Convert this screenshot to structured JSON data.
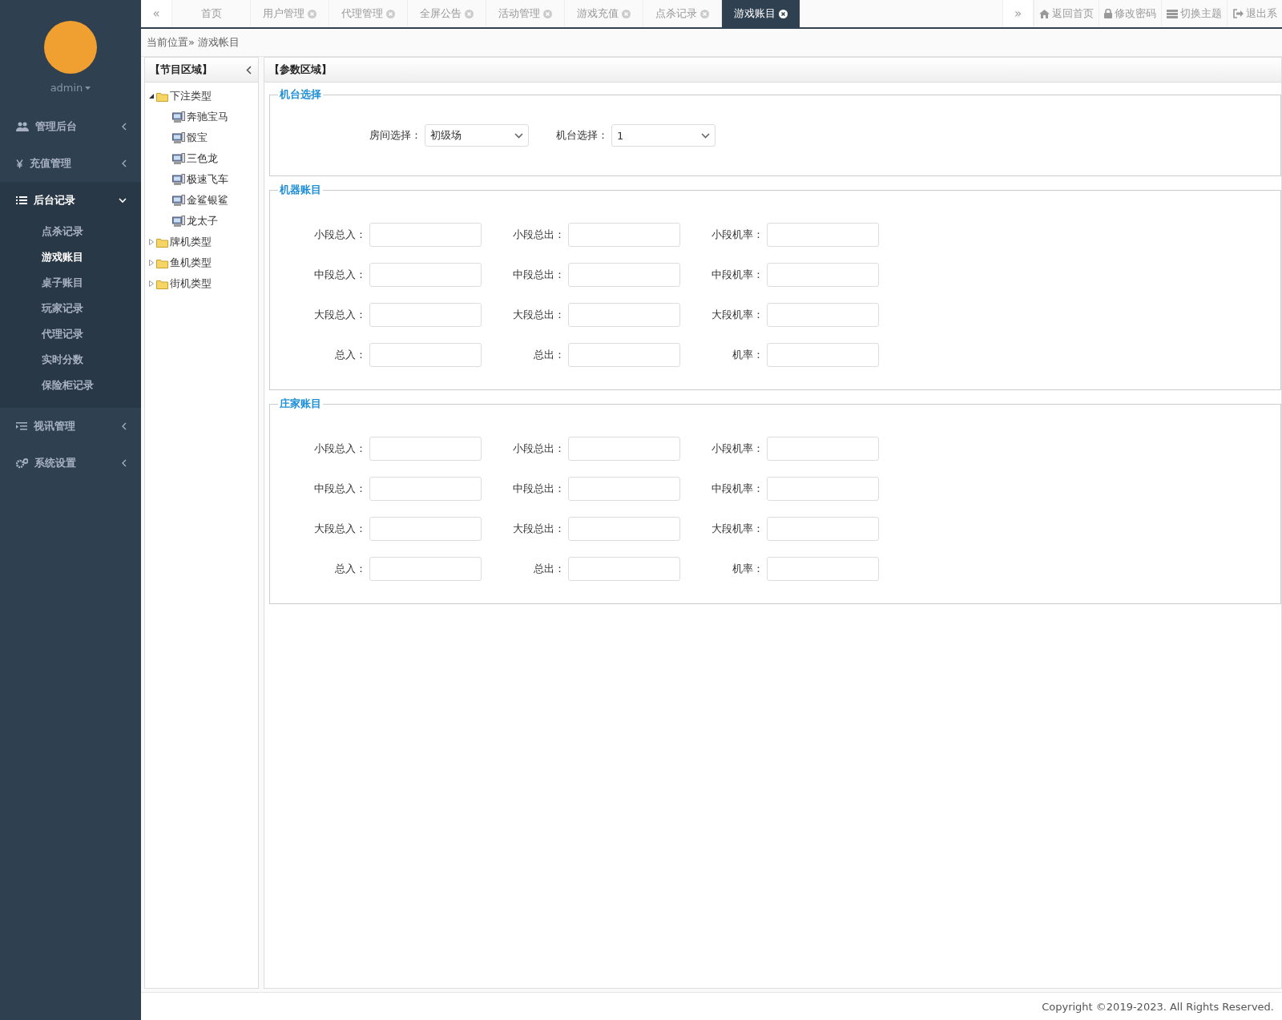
{
  "sidebar": {
    "user": "admin",
    "menu": [
      {
        "label": "管理后台",
        "expanded": false
      },
      {
        "label": "充值管理",
        "expanded": false
      },
      {
        "label": "后台记录",
        "expanded": true,
        "children": [
          {
            "label": "点杀记录",
            "selected": false
          },
          {
            "label": "游戏账目",
            "selected": true
          },
          {
            "label": "桌子账目",
            "selected": false
          },
          {
            "label": "玩家记录",
            "selected": false
          },
          {
            "label": "代理记录",
            "selected": false
          },
          {
            "label": "实时分数",
            "selected": false
          },
          {
            "label": "保险柜记录",
            "selected": false
          }
        ]
      },
      {
        "label": "视讯管理",
        "expanded": false
      },
      {
        "label": "系统设置",
        "expanded": false
      }
    ]
  },
  "tabbar": {
    "prev": "«",
    "next": "»",
    "tabs": [
      {
        "label": "首页",
        "selected": false,
        "closable": false
      },
      {
        "label": "用户管理",
        "selected": false,
        "closable": true
      },
      {
        "label": "代理管理",
        "selected": false,
        "closable": true
      },
      {
        "label": "全屏公告",
        "selected": false,
        "closable": true
      },
      {
        "label": "活动管理",
        "selected": false,
        "closable": true
      },
      {
        "label": "游戏充值",
        "selected": false,
        "closable": true
      },
      {
        "label": "点杀记录",
        "selected": false,
        "closable": true
      },
      {
        "label": "游戏账目",
        "selected": true,
        "closable": true
      }
    ],
    "actions": [
      "返回首页",
      "修改密码",
      "切换主题",
      "退出系"
    ]
  },
  "breadcrumb": "当前位置» 游戏帐目",
  "tree_panel": {
    "title": "【节目区域】",
    "tree": [
      {
        "label": "下注类型",
        "expanded": true,
        "children": [
          {
            "label": "奔驰宝马"
          },
          {
            "label": "骰宝"
          },
          {
            "label": "三色龙"
          },
          {
            "label": "极速飞车"
          },
          {
            "label": "金鲨银鲨"
          },
          {
            "label": "龙太子"
          }
        ]
      },
      {
        "label": "牌机类型",
        "expanded": false
      },
      {
        "label": "鱼机类型",
        "expanded": false
      },
      {
        "label": "街机类型",
        "expanded": false
      }
    ]
  },
  "params_panel": {
    "title": "【参数区域】",
    "sections": [
      {
        "title": "机台选择",
        "kind": "selects",
        "fields": [
          {
            "label": "房间选择：",
            "value": "初级场"
          },
          {
            "label": "机台选择：",
            "value": "1"
          }
        ]
      },
      {
        "title": "机器账目",
        "kind": "grid",
        "fields": [
          {
            "label": "小段总入："
          },
          {
            "label": "小段总出："
          },
          {
            "label": "小段机率："
          },
          {
            "label": "中段总入："
          },
          {
            "label": "中段总出："
          },
          {
            "label": "中段机率："
          },
          {
            "label": "大段总入："
          },
          {
            "label": "大段总出："
          },
          {
            "label": "大段机率："
          },
          {
            "label": "总入："
          },
          {
            "label": "总出："
          },
          {
            "label": "机率："
          }
        ]
      },
      {
        "title": "庄家账目",
        "kind": "grid",
        "fields": [
          {
            "label": "小段总入："
          },
          {
            "label": "小段总出："
          },
          {
            "label": "小段机率："
          },
          {
            "label": "中段总入："
          },
          {
            "label": "中段总出："
          },
          {
            "label": "中段机率："
          },
          {
            "label": "大段总入："
          },
          {
            "label": "大段总出："
          },
          {
            "label": "大段机率："
          },
          {
            "label": "总入："
          },
          {
            "label": "总出："
          },
          {
            "label": "机率："
          }
        ]
      }
    ]
  },
  "footer": "Copyright ©2019-2023. All Rights Reserved."
}
